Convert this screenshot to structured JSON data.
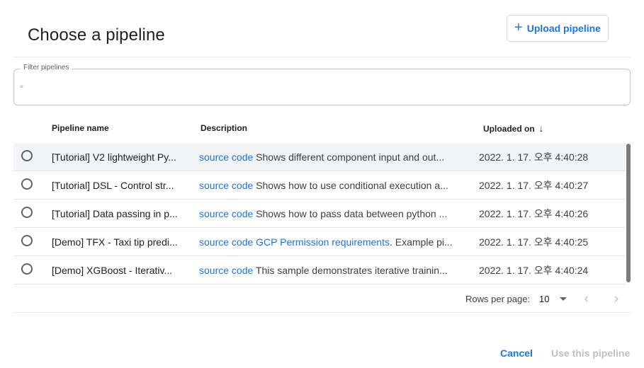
{
  "dialog": {
    "title": "Choose a pipeline",
    "upload_label": "Upload pipeline"
  },
  "filter": {
    "label": "Filter pipelines",
    "value": ""
  },
  "table": {
    "columns": {
      "name": "Pipeline name",
      "description": "Description",
      "uploaded": "Uploaded on"
    },
    "sort_icon": "arrow-down-icon",
    "rows": [
      {
        "name": "[Tutorial] V2 lightweight Py...",
        "links": [
          "source code"
        ],
        "desc": " Shows different component input and out...",
        "date": "2022. 1. 17. 오후 4:40:28",
        "selected": true
      },
      {
        "name": "[Tutorial] DSL - Control str...",
        "links": [
          "source code"
        ],
        "desc": " Shows how to use conditional execution a...",
        "date": "2022. 1. 17. 오후 4:40:27",
        "selected": false
      },
      {
        "name": "[Tutorial] Data passing in p...",
        "links": [
          "source code"
        ],
        "desc": " Shows how to pass data between python ...",
        "date": "2022. 1. 17. 오후 4:40:26",
        "selected": false
      },
      {
        "name": "[Demo] TFX - Taxi tip predi...",
        "links": [
          "source code",
          "GCP Permission requirements"
        ],
        "desc": ". Example pi...",
        "date": "2022. 1. 17. 오후 4:40:25",
        "selected": false
      },
      {
        "name": "[Demo] XGBoost - Iterativ...",
        "links": [
          "source code"
        ],
        "desc": " This sample demonstrates iterative trainin...",
        "date": "2022. 1. 17. 오후 4:40:24",
        "selected": false
      }
    ]
  },
  "pagination": {
    "rows_per_page_label": "Rows per page:",
    "rows_per_page": "10"
  },
  "actions": {
    "cancel": "Cancel",
    "use": "Use this pipeline"
  }
}
